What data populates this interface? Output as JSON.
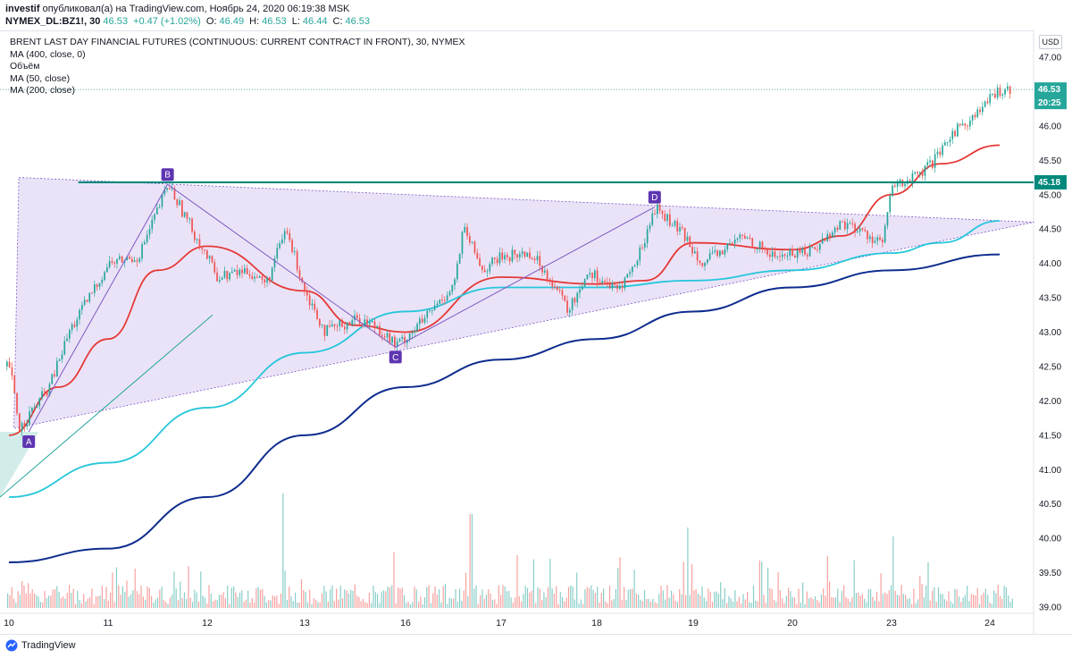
{
  "header": {
    "line1_user": "investif",
    "line1_text": "опубликовал(а) на TradingView.com, Ноябрь 24, 2020 06:19:38 MSK",
    "symbol": "NYMEX_DL:BZ1!, 30",
    "last": "46.53",
    "change": "+0.47 (+1.02%)",
    "open_label": "O:",
    "open": "46.49",
    "high_label": "H:",
    "high": "46.53",
    "low_label": "L:",
    "low": "46.44",
    "close_label": "C:",
    "close": "46.53"
  },
  "legend": {
    "title": "BRENT LAST DAY FINANCIAL FUTURES (CONTINUOUS: CURRENT CONTRACT IN FRONT), 30, NYMEX",
    "ma400": "MA (400, close, 0)",
    "volume": "Объём",
    "ma50": "MA (50, close)",
    "ma200": "MA (200, close)"
  },
  "currency": "USD",
  "footer": {
    "brand": "TradingView"
  },
  "colors": {
    "up": "#26a69a",
    "down": "#ef5350",
    "ma50": "#e53935",
    "ma200": "#26c6da",
    "ma400": "#0d2c8e",
    "triangle_fill": "#e3d9f5",
    "pattern": "#7e57c2",
    "resistance": "#00897b"
  },
  "chart_data": {
    "type": "candlestick",
    "y_ticks": [
      "47.00",
      "46.50",
      "46.00",
      "45.50",
      "45.00",
      "44.50",
      "44.00",
      "43.50",
      "43.00",
      "42.50",
      "42.00",
      "41.50",
      "41.00",
      "40.50",
      "40.00",
      "39.50",
      "39.00"
    ],
    "ylim": [
      38.95,
      47.35
    ],
    "x_labels": [
      "10",
      "11",
      "12",
      "13",
      "16",
      "17",
      "18",
      "19",
      "20",
      "23",
      "24"
    ],
    "price_labels": {
      "last": "46.53",
      "countdown": "20:25",
      "resistance": "45.18"
    },
    "resistance_level": 45.18,
    "last_price": 46.53,
    "pattern_points": [
      {
        "label": "A",
        "t": 0.2,
        "price": 41.55
      },
      {
        "label": "B",
        "t": 1.6,
        "price": 45.15
      },
      {
        "label": "C",
        "t": 3.9,
        "price": 42.78
      },
      {
        "label": "D",
        "t": 6.6,
        "price": 44.82
      }
    ],
    "ma_series": [
      {
        "name": "MA (50, close)",
        "t": [
          0,
          0.5,
          1,
          1.5,
          2,
          3,
          3.5,
          4,
          5,
          6,
          6.5,
          7,
          8,
          8.5,
          9,
          9.5,
          10.1
        ],
        "price": [
          41.5,
          42.2,
          42.9,
          43.9,
          44.25,
          43.6,
          43.1,
          43.0,
          43.8,
          43.7,
          43.75,
          44.3,
          44.2,
          44.4,
          45.0,
          45.45,
          45.72
        ]
      },
      {
        "name": "MA (200, close)",
        "t": [
          0,
          1,
          2,
          3,
          4,
          5,
          6,
          7,
          8,
          9,
          9.5,
          10.1
        ],
        "price": [
          40.6,
          41.1,
          41.9,
          42.7,
          43.3,
          43.65,
          43.65,
          43.75,
          43.9,
          44.15,
          44.3,
          44.62
        ]
      },
      {
        "name": "MA (400, close, 0)",
        "t": [
          0,
          1,
          2,
          3,
          4,
          5,
          6,
          7,
          8,
          9,
          10.1
        ],
        "price": [
          39.65,
          39.85,
          40.6,
          41.5,
          42.2,
          42.6,
          42.9,
          43.3,
          43.65,
          43.9,
          44.13
        ]
      }
    ]
  }
}
